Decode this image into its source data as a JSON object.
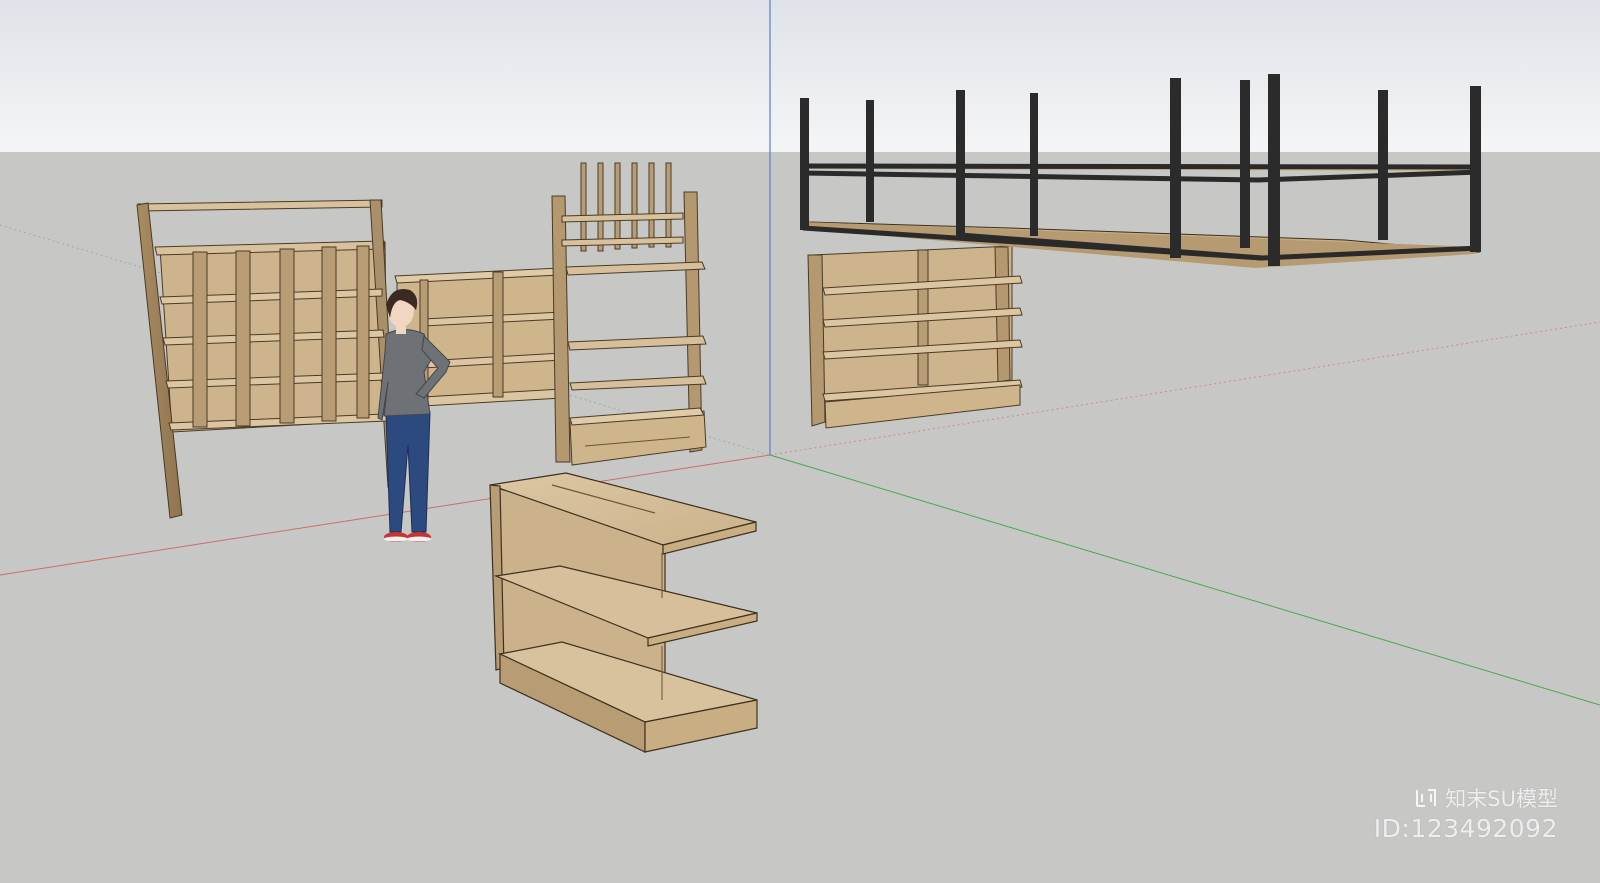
{
  "watermark": {
    "brand": "知末SU模型",
    "id": "ID:123492092",
    "logo_icon": "brand-logo-icon"
  },
  "scene": {
    "sky_top": "#e2e5ea",
    "sky_bottom": "#f3f4f6",
    "ground": "#c7c8c6",
    "wood_light": "#d9c4a2",
    "wood_mid": "#c4aa80",
    "wood_dark": "#9c8058",
    "metal": "#2b2b2b",
    "axis_red": "#cf6a6a",
    "axis_green": "#47a64a",
    "axis_blue": "#5b7bd6"
  }
}
